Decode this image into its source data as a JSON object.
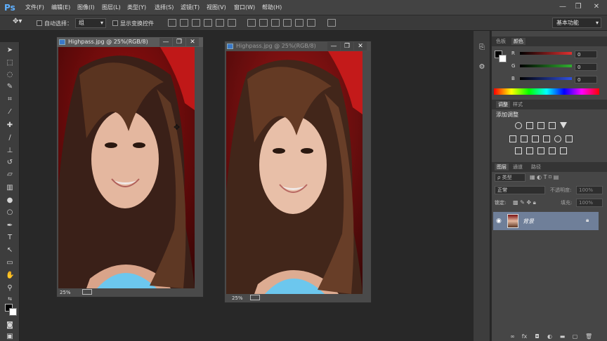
{
  "app": {
    "logo": "Ps"
  },
  "menu": [
    "文件(F)",
    "编辑(E)",
    "图像(I)",
    "图层(L)",
    "类型(Y)",
    "选择(S)",
    "滤镜(T)",
    "视图(V)",
    "窗口(W)",
    "帮助(H)"
  ],
  "window_controls": {
    "minimize": "—",
    "restore": "❐",
    "close": "✕"
  },
  "options_bar": {
    "auto_select_label": "自动选择：",
    "auto_select_value": "组",
    "show_transform_label": "显示变换控件",
    "workspace": "基本功能"
  },
  "documents": [
    {
      "title": "Highpass.jpg @ 25%(RGB/8)",
      "zoom": "25%"
    },
    {
      "title": "Highpass.jpg @ 25%(RGB/8)",
      "zoom": "25%"
    }
  ],
  "color_panel": {
    "tabs": [
      "色板",
      "颜色"
    ],
    "channels": [
      {
        "label": "R",
        "value": "0",
        "color": "#e03030"
      },
      {
        "label": "G",
        "value": "0",
        "color": "#30b030"
      },
      {
        "label": "B",
        "value": "0",
        "color": "#3050e0"
      }
    ]
  },
  "adjustments_panel": {
    "tabs": [
      "调整",
      "样式"
    ],
    "title": "添加调整"
  },
  "layers_panel": {
    "tabs": [
      "图层",
      "通道",
      "路径"
    ],
    "kind_filter": "ρ 类型",
    "blend_mode": "正常",
    "opacity_label": "不透明度:",
    "opacity_value": "100%",
    "lock_label": "锁定:",
    "fill_label": "填充:",
    "fill_value": "100%",
    "layers": [
      {
        "name": "背景",
        "visible": true,
        "locked": true
      }
    ]
  },
  "colors": {
    "accent": "#5fb0ff",
    "layer_selected": "#6f7f99",
    "menubar": "#434343"
  }
}
